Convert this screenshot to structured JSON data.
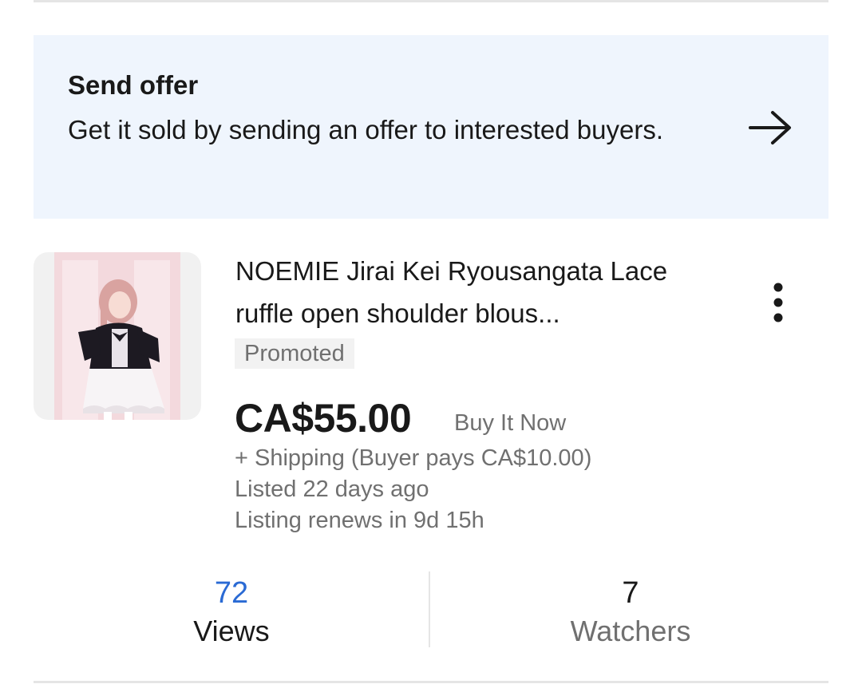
{
  "offer": {
    "title": "Send offer",
    "description": "Get it sold by sending an offer to interested buyers.",
    "icon": "arrow-right-icon"
  },
  "listing": {
    "title": "NOEMIE Jirai Kei Ryousangata Lace ruffle open shoulder blous...",
    "badge": "Promoted",
    "price": "CA$55.00",
    "format": "Buy It Now",
    "shipping": "+ Shipping (Buyer pays CA$10.00)",
    "listed": "Listed 22 days ago",
    "renews": "Listing renews in 9d 15h",
    "menu_icon": "more-vertical-icon"
  },
  "stats": {
    "views": {
      "value": "72",
      "label": "Views"
    },
    "watchers": {
      "value": "7",
      "label": "Watchers"
    }
  },
  "colors": {
    "banner_bg": "#eff5fd",
    "link_blue": "#2a6ad4",
    "secondary_text": "#707070"
  }
}
